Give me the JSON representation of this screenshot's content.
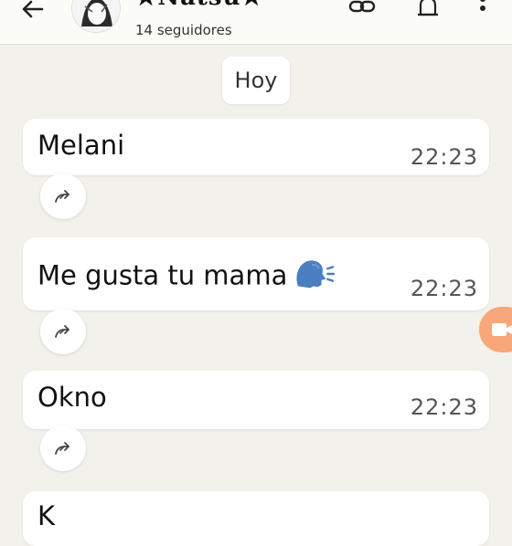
{
  "header": {
    "channel_name": "★Natsu★",
    "followers": "14 seguidores"
  },
  "date_chip": "Hoy",
  "messages": [
    {
      "text": "Melani",
      "time": "22:23"
    },
    {
      "text": "Me gusta tu mama",
      "emoji": "speaking-head",
      "time": "22:23"
    },
    {
      "text": "Okno",
      "time": "22:23"
    },
    {
      "text": "K",
      "time": ""
    }
  ],
  "icons": {
    "back": "back-arrow-icon",
    "link": "link-icon",
    "bell": "bell-icon",
    "menu": "more-vert-icon",
    "forward": "forward-icon",
    "video": "video-call-icon"
  },
  "colors": {
    "background": "#f2f1ec",
    "bubble": "#ffffff",
    "fab": "#f7a77a"
  }
}
